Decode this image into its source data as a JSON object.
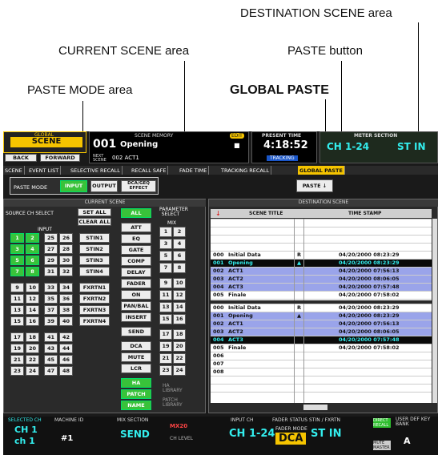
{
  "annotations": {
    "destination": "DESTINATION SCENE area",
    "current": "CURRENT SCENE area",
    "paste_button": "PASTE button",
    "paste_mode": "PASTE MODE area",
    "global_paste": "GLOBAL PASTE"
  },
  "header": {
    "global": "GLOBAL",
    "scene": "SCENE",
    "back": "BACK",
    "forward": "FORWARD",
    "scene_memory": "SCENE MEMORY",
    "edit": "EDIT",
    "scene_no": "001",
    "scene_name": "Opening",
    "next_label": "NEXT SCENE",
    "next_scene": "002 ACT1",
    "present_time": "PRESENT TIME",
    "time": "4:18:52",
    "tracking": "TRACKING",
    "meter_section": "METER SECTION",
    "meter_a": "CH 1-24",
    "meter_b": "ST IN"
  },
  "tabs": [
    "SCENE",
    "EVENT LIST",
    "SELECTIVE RECALL",
    "RECALL SAFE",
    "FADE TIME",
    "TRACKING RECALL",
    "GLOBAL PASTE"
  ],
  "paste_mode": {
    "label": "PASTE MODE",
    "input": "INPUT",
    "output": "OUTPUT",
    "dca": "DCA/GEQ EFFECT"
  },
  "paste_button": "PASTE ↓",
  "current": {
    "title": "CURRENT SCENE",
    "source": "SOURCE CH SELECT",
    "set_all": "SET ALL",
    "clear_all": "CLEAR ALL",
    "input": "INPUT",
    "channels": [
      [
        "1",
        "2",
        "25",
        "26"
      ],
      [
        "3",
        "4",
        "27",
        "28"
      ],
      [
        "5",
        "6",
        "29",
        "30"
      ],
      [
        "7",
        "8",
        "31",
        "32"
      ],
      [
        "9",
        "10",
        "33",
        "34"
      ],
      [
        "11",
        "12",
        "35",
        "36"
      ],
      [
        "13",
        "14",
        "37",
        "38"
      ],
      [
        "15",
        "16",
        "39",
        "40"
      ],
      [
        "17",
        "18",
        "41",
        "42"
      ],
      [
        "19",
        "20",
        "43",
        "44"
      ],
      [
        "21",
        "22",
        "45",
        "46"
      ],
      [
        "23",
        "24",
        "47",
        "48"
      ]
    ],
    "stins": [
      "STIN1",
      "STIN2",
      "STIN3",
      "STIN4",
      "FXRTN1",
      "FXRTN2",
      "FXRTN3",
      "FXRTN4"
    ],
    "params": [
      "ALL",
      "ATT",
      "EQ",
      "GATE",
      "COMP",
      "DELAY",
      "FADER",
      "ON",
      "PAN/BAL",
      "INSERT",
      "SEND",
      "DCA",
      "MUTE",
      "LCR",
      "HA",
      "PATCH",
      "NAME"
    ],
    "param_select": "PARAMETER SELECT",
    "mix": "MIX",
    "mix_pairs": [
      [
        "1",
        "2"
      ],
      [
        "3",
        "4"
      ],
      [
        "5",
        "6"
      ],
      [
        "7",
        "8"
      ],
      [
        "9",
        "10"
      ],
      [
        "11",
        "12"
      ],
      [
        "13",
        "14"
      ],
      [
        "15",
        "16"
      ],
      [
        "17",
        "18"
      ],
      [
        "19",
        "20"
      ],
      [
        "21",
        "22"
      ],
      [
        "23",
        "24"
      ]
    ],
    "ha_lib": "HA LIBRARY",
    "patch_lib": "PATCH LIBRARY"
  },
  "dest": {
    "title": "DESTINATION SCENE",
    "col_title": "SCENE TITLE",
    "col_time": "TIME STAMP",
    "arrow": "↓",
    "upper": [
      {
        "n": "000",
        "t": "Initial Data",
        "f": "R",
        "ts": "04/20/2000 08:23:29",
        "s": ""
      },
      {
        "n": "001",
        "t": "Opening",
        "f": "lock",
        "ts": "04/20/2000 08:23:29",
        "s": "sel"
      },
      {
        "n": "002",
        "t": "ACT1",
        "f": "",
        "ts": "04/20/2000 07:56:13",
        "s": "blue"
      },
      {
        "n": "003",
        "t": "ACT2",
        "f": "",
        "ts": "04/20/2000 08:06:05",
        "s": "blue"
      },
      {
        "n": "004",
        "t": "ACT3",
        "f": "",
        "ts": "04/20/2000 07:57:48",
        "s": "blue"
      },
      {
        "n": "005",
        "t": "Finale",
        "f": "",
        "ts": "04/20/2000 07:58:02",
        "s": ""
      }
    ],
    "lower": [
      {
        "n": "000",
        "t": "Initial Data",
        "f": "R",
        "ts": "04/20/2000 08:23:29",
        "s": ""
      },
      {
        "n": "001",
        "t": "Opening",
        "f": "lock",
        "ts": "04/20/2000 08:23:29",
        "s": "blue"
      },
      {
        "n": "002",
        "t": "ACT1",
        "f": "",
        "ts": "04/20/2000 07:56:13",
        "s": "blue"
      },
      {
        "n": "003",
        "t": "ACT2",
        "f": "",
        "ts": "04/20/2000 08:06:05",
        "s": "blue"
      },
      {
        "n": "004",
        "t": "ACT3",
        "f": "",
        "ts": "04/20/2000 07:57:48",
        "s": "sel"
      },
      {
        "n": "005",
        "t": "Finale",
        "f": "",
        "ts": "04/20/2000 07:58:02",
        "s": ""
      },
      {
        "n": "006",
        "t": "",
        "f": "",
        "ts": "",
        "s": ""
      },
      {
        "n": "007",
        "t": "",
        "f": "",
        "ts": "",
        "s": ""
      },
      {
        "n": "008",
        "t": "",
        "f": "",
        "ts": "",
        "s": ""
      }
    ]
  },
  "footer": {
    "selected_ch": "SELECTED CH",
    "ch": "CH 1",
    "ch_name": "ch 1",
    "machine_id": "MACHINE ID",
    "id": "#1",
    "mix_section": "MIX SECTION",
    "send": "SEND",
    "mix": "MX20",
    "ch_level": "CH LEVEL",
    "input_ch": "INPUT CH",
    "fader_status": "FADER STATUS",
    "stin_fxrtn": "STIN / FXRTN",
    "ch_range": "CH 1-24",
    "fader_mode": "FADER MODE",
    "dca": "DCA",
    "st_in": "ST IN",
    "direct_recall": "DIRECT RECALL",
    "mute_master": "MUTE MASTER",
    "user_def": "USER DEF KEY BANK",
    "bank": "A"
  }
}
